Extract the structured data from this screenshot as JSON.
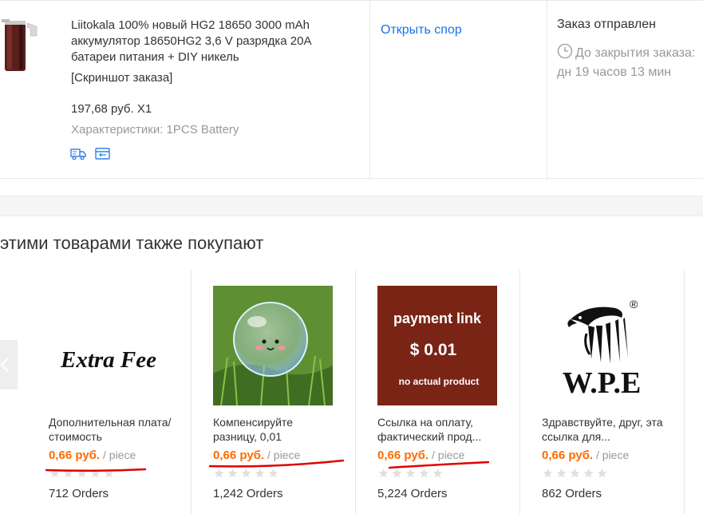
{
  "order": {
    "product_title": "Liitokala 100% новый HG2 18650 3000 mAh аккумулятор 18650HG2 3,6 V разрядка 20A батареи питания + DIY никель",
    "snapshot_link": "[Скриншот заказа]",
    "price_qty": "197,68 руб. X1",
    "specs": "Характеристики: 1PCS Battery",
    "dispute_link": "Открыть спор",
    "status": "Заказ отправлен",
    "countdown_line1": "До закрытия заказа:",
    "countdown_line2": "дн 19 часов 13 мин"
  },
  "recommendations": {
    "title": "этими товарами также покупают",
    "items": [
      {
        "title": "Дополнительная плата/стоимость",
        "image_text": "Extra Fee",
        "price": "0,66 руб.",
        "unit": " / piece",
        "orders": "712 Orders"
      },
      {
        "title": "Компенсируйте разницу, 0,01",
        "price": "0,66 руб.",
        "unit": " / piece",
        "orders": "1,242 Orders"
      },
      {
        "title": "Ссылка на оплату, фактический прод...",
        "image_line1": "payment link",
        "image_line2": "$ 0.01",
        "image_line3": "no actual product",
        "price": "0,66 руб.",
        "unit": " / piece",
        "orders": "5,224 Orders"
      },
      {
        "title": "Здравствуйте, друг, эта ссылка для...",
        "image_text": "W.P.E",
        "image_mark": "®",
        "price": "0,66 руб.",
        "unit": " / piece",
        "orders": "862 Orders"
      }
    ]
  },
  "colors": {
    "price": "#ff6a00",
    "link": "#1a73e8",
    "annotation_underline": "#e00000",
    "star_empty": "#e0e0e0",
    "payment_bg": "#7a2416"
  },
  "icons": [
    "battery-thumbnail",
    "truck-icon",
    "receipt-icon",
    "clock-icon",
    "chevron-left-icon",
    "star-icon",
    "eagle-logo"
  ]
}
